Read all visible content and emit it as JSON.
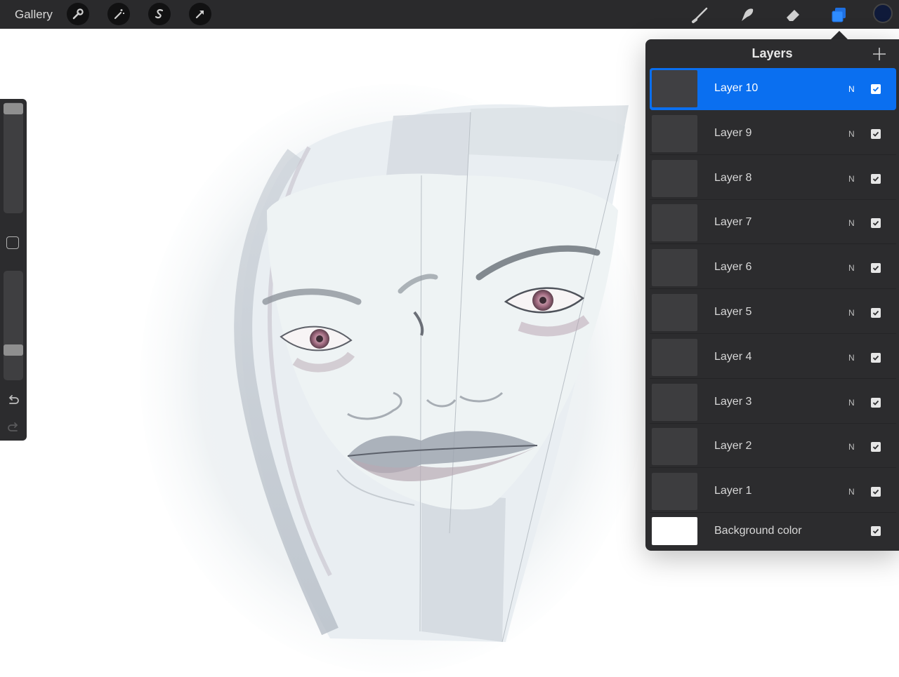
{
  "topbar": {
    "gallery_label": "Gallery",
    "left_tools": [
      "wrench-icon",
      "magic-wand-icon",
      "selection-s-icon",
      "transform-arrow-icon"
    ],
    "right_tools": [
      "brush-icon",
      "smudge-icon",
      "eraser-icon",
      "layers-icon"
    ],
    "active_tool": "layers-icon",
    "current_color": "#0f1a3a"
  },
  "sidebar": {
    "brush_size_level": 0.0,
    "opacity_level": 0.78,
    "icons": [
      "modifier-square-icon",
      "undo-icon",
      "redo-icon"
    ]
  },
  "layers": {
    "title": "Layers",
    "add_icon": "plus-icon",
    "items": [
      {
        "name": "Layer 10",
        "blend": "N",
        "visible": true,
        "active": true
      },
      {
        "name": "Layer 9",
        "blend": "N",
        "visible": true,
        "active": false
      },
      {
        "name": "Layer 8",
        "blend": "N",
        "visible": true,
        "active": false
      },
      {
        "name": "Layer 7",
        "blend": "N",
        "visible": true,
        "active": false
      },
      {
        "name": "Layer 6",
        "blend": "N",
        "visible": true,
        "active": false
      },
      {
        "name": "Layer 5",
        "blend": "N",
        "visible": true,
        "active": false
      },
      {
        "name": "Layer 4",
        "blend": "N",
        "visible": true,
        "active": false
      },
      {
        "name": "Layer 3",
        "blend": "N",
        "visible": true,
        "active": false
      },
      {
        "name": "Layer 2",
        "blend": "N",
        "visible": true,
        "active": false
      },
      {
        "name": "Layer 1",
        "blend": "N",
        "visible": true,
        "active": false
      }
    ],
    "background": {
      "name": "Background color",
      "color": "#ffffff",
      "visible": true
    }
  },
  "colors": {
    "accent": "#0a6ff0",
    "panel": "#2c2c2e",
    "topbar": "#2a2a2c"
  }
}
